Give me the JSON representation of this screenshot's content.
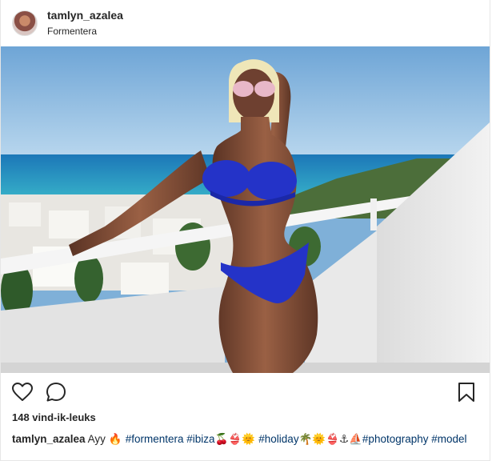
{
  "post": {
    "username": "tamlyn_azalea",
    "location": "Formentera",
    "likes_text": "148 vind-ik-leuks",
    "caption": {
      "user": "tamlyn_azalea",
      "text": "Ayy",
      "tags": [
        {
          "text": "🔥 ",
          "kind": "emoji"
        },
        {
          "text": "#formentera",
          "kind": "tag"
        },
        {
          "text": " ",
          "kind": "plain"
        },
        {
          "text": "#ibiza",
          "kind": "tag"
        },
        {
          "text": "🍒👙🌞 ",
          "kind": "emoji"
        },
        {
          "text": "#holiday",
          "kind": "tag"
        },
        {
          "text": "🌴🌞👙⚓⛵",
          "kind": "emoji"
        },
        {
          "text": "#photography",
          "kind": "tag"
        },
        {
          "text": " ",
          "kind": "plain"
        },
        {
          "text": "#model",
          "kind": "tag"
        }
      ]
    }
  },
  "icons": {
    "like": "heart-icon",
    "comment": "comment-icon",
    "save": "bookmark-icon"
  },
  "colors": {
    "tag": "#003569",
    "text": "#262626",
    "border": "#e6e6e6"
  }
}
